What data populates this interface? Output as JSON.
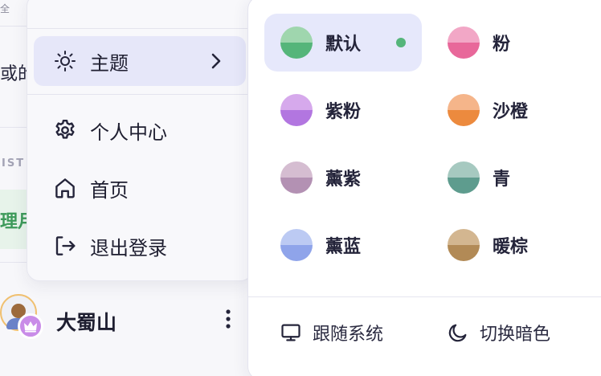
{
  "background": {
    "top_fragment": "全",
    "text_fragment_1": "或的",
    "section_fragment": "IST",
    "nav_fragment": "理月"
  },
  "user": {
    "name": "大蜀山"
  },
  "menu": {
    "items": [
      {
        "label": "主题",
        "icon": "sun-icon",
        "active": true
      },
      {
        "label": "个人中心",
        "icon": "gear-icon"
      },
      {
        "label": "首页",
        "icon": "home-icon"
      },
      {
        "label": "退出登录",
        "icon": "logout-icon"
      }
    ]
  },
  "themes": {
    "selected": "默认",
    "options": [
      {
        "label": "默认",
        "color_top": "#9fd6ae",
        "color_bottom": "#55b57a"
      },
      {
        "label": "粉",
        "color_top": "#f2a7c6",
        "color_bottom": "#e8689a"
      },
      {
        "label": "紫粉",
        "color_top": "#d6a9ec",
        "color_bottom": "#b276e0"
      },
      {
        "label": "沙橙",
        "color_top": "#f5b58a",
        "color_bottom": "#ec8a3e"
      },
      {
        "label": "薰紫",
        "color_top": "#d5bdd1",
        "color_bottom": "#b391b3"
      },
      {
        "label": "青",
        "color_top": "#a6c9c0",
        "color_bottom": "#5e9c8e"
      },
      {
        "label": "薰蓝",
        "color_top": "#bccaf3",
        "color_bottom": "#8fa4ea"
      },
      {
        "label": "暖棕",
        "color_top": "#d3b690",
        "color_bottom": "#b28a56"
      }
    ]
  },
  "actions": {
    "follow_system": "跟随系统",
    "toggle_dark": "切换暗色"
  }
}
